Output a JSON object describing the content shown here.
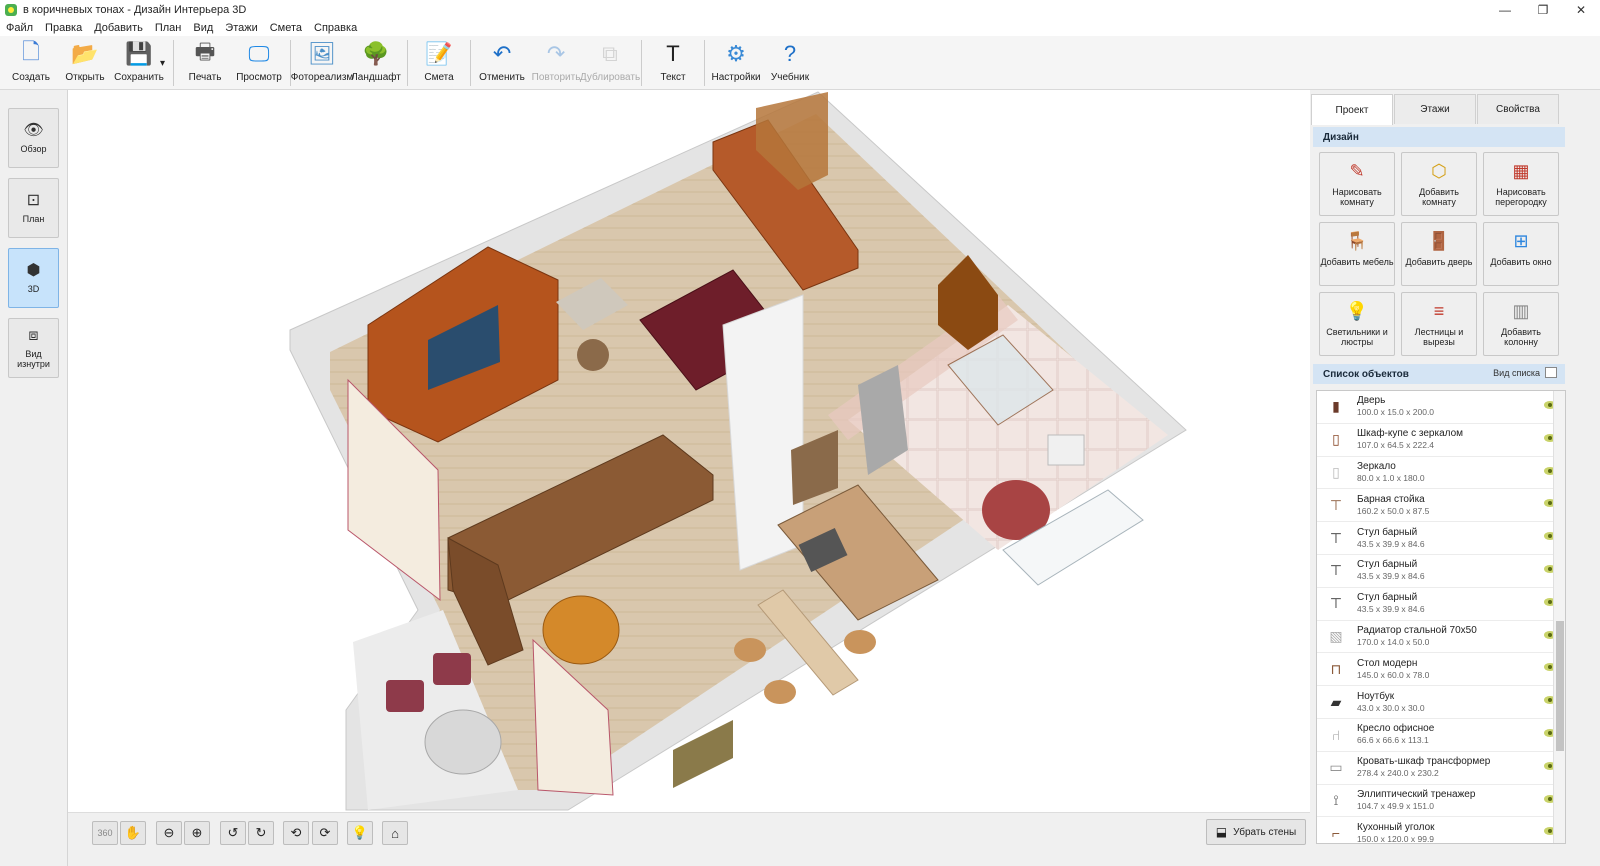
{
  "window": {
    "title": "в коричневых тонах - Дизайн Интерьера 3D",
    "minimize": "—",
    "restore": "❐",
    "close": "✕"
  },
  "menu": [
    "Файл",
    "Правка",
    "Добавить",
    "План",
    "Вид",
    "Этажи",
    "Смета",
    "Справка"
  ],
  "toolbar": [
    {
      "label": "Создать",
      "icon": "new-file-icon",
      "glyph": "🗋",
      "color": "#3a7bd5",
      "disabled": false
    },
    {
      "label": "Открыть",
      "icon": "open-folder-icon",
      "glyph": "📂",
      "color": "#e0a020",
      "disabled": false
    },
    {
      "label": "Сохранить",
      "icon": "save-disk-icon",
      "glyph": "💾",
      "color": "#2d6db5",
      "disabled": false
    },
    {
      "label": "Печать",
      "icon": "printer-icon",
      "glyph": "🖶",
      "color": "#555",
      "disabled": false
    },
    {
      "label": "Просмотр",
      "icon": "monitor-icon",
      "glyph": "🖵",
      "color": "#1e88e5",
      "disabled": false
    },
    {
      "label": "Фотореализм",
      "icon": "photo-icon",
      "glyph": "🖼",
      "color": "#4a8fc8",
      "disabled": false
    },
    {
      "label": "Ландшафт",
      "icon": "tree-icon",
      "glyph": "🌳",
      "color": "#2e7d32",
      "disabled": false
    },
    {
      "label": "Смета",
      "icon": "estimate-notepad-icon",
      "glyph": "📝",
      "color": "#e09a3a",
      "disabled": false
    },
    {
      "label": "Отменить",
      "icon": "undo-icon",
      "glyph": "↶",
      "color": "#1e70c8",
      "disabled": false
    },
    {
      "label": "Повторить",
      "icon": "redo-icon",
      "glyph": "↷",
      "color": "#1e70c8",
      "disabled": true
    },
    {
      "label": "Дублировать",
      "icon": "duplicate-icon",
      "glyph": "⧉",
      "color": "#999",
      "disabled": true
    },
    {
      "label": "Текст",
      "icon": "text-icon",
      "glyph": "T",
      "color": "#222",
      "disabled": false
    },
    {
      "label": "Настройки",
      "icon": "gear-icon",
      "glyph": "⚙",
      "color": "#3a8ad6",
      "disabled": false
    },
    {
      "label": "Учебник",
      "icon": "help-icon",
      "glyph": "?",
      "color": "#1e70c8",
      "disabled": false
    }
  ],
  "views": [
    {
      "label": "Обзор",
      "icon": "eye-icon",
      "glyph": "👁",
      "active": false
    },
    {
      "label": "План",
      "icon": "plan-icon",
      "glyph": "⊡",
      "active": false
    },
    {
      "label": "3D",
      "icon": "cube-icon",
      "glyph": "⬢",
      "active": true
    },
    {
      "label": "Вид изнутри",
      "icon": "inside-view-icon",
      "glyph": "⧈",
      "active": false
    }
  ],
  "bottom": {
    "nav": [
      {
        "icon": "rotate-360-icon",
        "glyph": "360"
      },
      {
        "icon": "hand-pan-icon",
        "glyph": "✋"
      },
      {
        "icon": "zoom-out-icon",
        "glyph": "⊖"
      },
      {
        "icon": "zoom-in-icon",
        "glyph": "⊕"
      },
      {
        "icon": "rotate-left-icon",
        "glyph": "↺"
      },
      {
        "icon": "rotate-right-icon",
        "glyph": "↻"
      },
      {
        "icon": "tilt-up-icon",
        "glyph": "⟲"
      },
      {
        "icon": "tilt-down-icon",
        "glyph": "⟳"
      },
      {
        "icon": "light-bulb-icon",
        "glyph": "💡"
      },
      {
        "icon": "home-icon",
        "glyph": "⌂"
      }
    ],
    "remove_walls": "Убрать стены"
  },
  "panel": {
    "tabs": [
      "Проект",
      "Этажи",
      "Свойства"
    ],
    "design_title": "Дизайн",
    "design_buttons": [
      {
        "label": "Нарисовать комнату",
        "icon": "draw-room-icon",
        "glyph": "✎",
        "color": "#c0392b"
      },
      {
        "label": "Добавить комнату",
        "icon": "add-room-icon",
        "glyph": "⬡",
        "color": "#d4a017"
      },
      {
        "label": "Нарисовать перегородку",
        "icon": "brick-wall-icon",
        "glyph": "▦",
        "color": "#c0392b"
      },
      {
        "label": "Добавить мебель",
        "icon": "armchair-icon",
        "glyph": "🪑",
        "color": "#2e86de"
      },
      {
        "label": "Добавить дверь",
        "icon": "door-icon",
        "glyph": "🚪",
        "color": "#e67e22"
      },
      {
        "label": "Добавить окно",
        "icon": "window-icon",
        "glyph": "⊞",
        "color": "#2e86de"
      },
      {
        "label": "Светильники и люстры",
        "icon": "lamp-icon",
        "glyph": "💡",
        "color": "#e74c3c"
      },
      {
        "label": "Лестницы и вырезы",
        "icon": "stairs-icon",
        "glyph": "≡",
        "color": "#c0392b"
      },
      {
        "label": "Добавить колонну",
        "icon": "column-icon",
        "glyph": "▥",
        "color": "#888"
      }
    ],
    "objects_title": "Список объектов",
    "list_mode": "Вид списка",
    "objects": [
      {
        "name": "Дверь",
        "dims": "100.0 x 15.0 x 200.0",
        "icon": "door-thumb-icon",
        "glyph": "▮",
        "color": "#6b3a2a"
      },
      {
        "name": "Шкаф-купе с зеркалом",
        "dims": "107.0 x 64.5 x 222.4",
        "icon": "wardrobe-thumb-icon",
        "glyph": "▯",
        "color": "#8b4a2a"
      },
      {
        "name": "Зеркало",
        "dims": "80.0 x 1.0 x 180.0",
        "icon": "mirror-thumb-icon",
        "glyph": "▯",
        "color": "#bbb"
      },
      {
        "name": "Барная стойка",
        "dims": "160.2 x 50.0 x 87.5",
        "icon": "bar-counter-thumb-icon",
        "glyph": "⊤",
        "color": "#8b5a3a"
      },
      {
        "name": "Стул барный",
        "dims": "43.5 x 39.9 x 84.6",
        "icon": "bar-stool-thumb-icon",
        "glyph": "⊤",
        "color": "#333"
      },
      {
        "name": "Стул барный",
        "dims": "43.5 x 39.9 x 84.6",
        "icon": "bar-stool-thumb-icon",
        "glyph": "⊤",
        "color": "#333"
      },
      {
        "name": "Стул барный",
        "dims": "43.5 x 39.9 x 84.6",
        "icon": "bar-stool-thumb-icon",
        "glyph": "⊤",
        "color": "#333"
      },
      {
        "name": "Радиатор стальной 70х50",
        "dims": "170.0 x 14.0 x 50.0",
        "icon": "radiator-thumb-icon",
        "glyph": "▧",
        "color": "#aaa"
      },
      {
        "name": "Стол модерн",
        "dims": "145.0 x 60.0 x 78.0",
        "icon": "table-thumb-icon",
        "glyph": "⊓",
        "color": "#8b5a3a"
      },
      {
        "name": "Ноутбук",
        "dims": "43.0 x 30.0 x 30.0",
        "icon": "laptop-thumb-icon",
        "glyph": "▰",
        "color": "#333"
      },
      {
        "name": "Кресло офисное",
        "dims": "66.6 x 66.6 x 113.1",
        "icon": "office-chair-thumb-icon",
        "glyph": "⑁",
        "color": "#999"
      },
      {
        "name": "Кровать-шкаф трансформер",
        "dims": "278.4 x 240.0 x 230.2",
        "icon": "bed-wardrobe-thumb-icon",
        "glyph": "▭",
        "color": "#888"
      },
      {
        "name": "Эллиптический тренажер",
        "dims": "104.7 x 49.9 x 151.0",
        "icon": "elliptical-thumb-icon",
        "glyph": "⟟",
        "color": "#555"
      },
      {
        "name": "Кухонный уголок",
        "dims": "150.0 x 120.0 x 99.9",
        "icon": "kitchen-corner-thumb-icon",
        "glyph": "⌐",
        "color": "#8b5a3a"
      }
    ]
  }
}
